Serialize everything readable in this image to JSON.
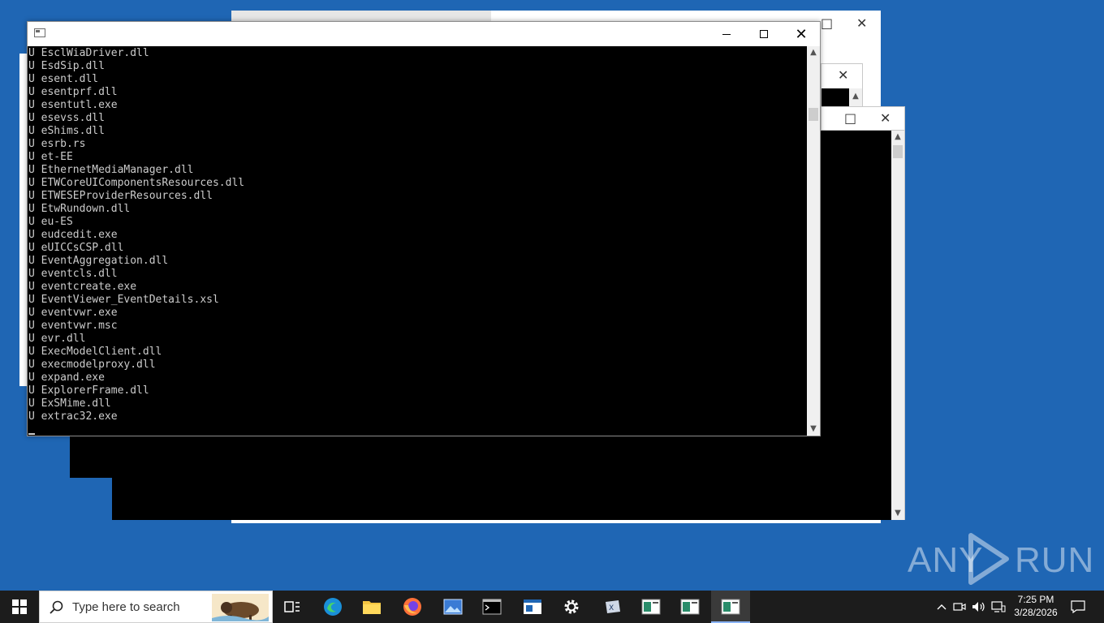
{
  "console": {
    "lines": [
      "U EsclWiaDriver.dll",
      "U EsdSip.dll",
      "U esent.dll",
      "U esentprf.dll",
      "U esentutl.exe",
      "U esevss.dll",
      "U eShims.dll",
      "U esrb.rs",
      "U et-EE",
      "U EthernetMediaManager.dll",
      "U ETWCoreUIComponentsResources.dll",
      "U ETWESEProviderResources.dll",
      "U EtwRundown.dll",
      "U eu-ES",
      "U eudcedit.exe",
      "U eUICCsCSP.dll",
      "U EventAggregation.dll",
      "U eventcls.dll",
      "U eventcreate.exe",
      "U EventViewer_EventDetails.xsl",
      "U eventvwr.exe",
      "U eventvwr.msc",
      "U evr.dll",
      "U ExecModelClient.dll",
      "U execmodelproxy.dll",
      "U expand.exe",
      "U ExplorerFrame.dll",
      "U ExSMime.dll",
      "U extrac32.exe"
    ]
  },
  "taskbar": {
    "search_placeholder": "Type here to search",
    "time": "7:25 PM",
    "date": "3/28/2026",
    "apps": [
      "start-icon",
      "task-view-icon",
      "edge-icon",
      "file-explorer-icon",
      "firefox-icon",
      "photos-icon",
      "terminal-icon",
      "window-icon",
      "settings-icon",
      "xps-viewer-icon",
      "console-app-icon",
      "console-app-icon",
      "console-app-icon"
    ]
  },
  "watermark": {
    "left": "ANY",
    "right": "RUN"
  },
  "colors": {
    "desktop": "#1f66b4",
    "taskbar": "#1c1c1c",
    "console_text": "#cccccc"
  }
}
